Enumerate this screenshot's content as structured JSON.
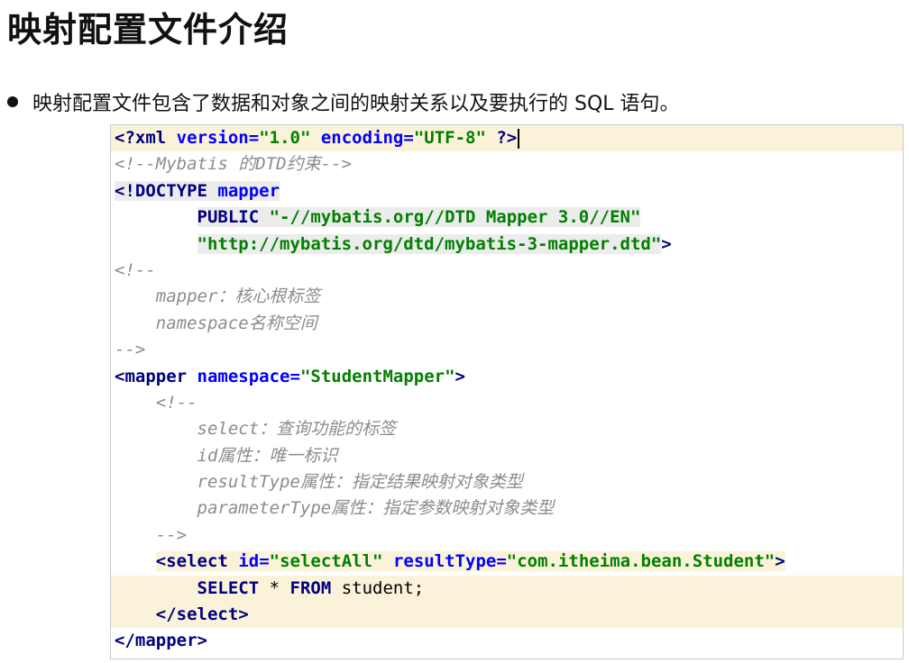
{
  "title": "映射配置文件介绍",
  "bullet": "映射配置文件包含了数据和对象之间的映射关系以及要执行的 SQL 语句。",
  "code": {
    "decl_open": "<?",
    "decl_xml": "xml",
    "decl_version_attr": "version",
    "decl_version_val": "\"1.0\"",
    "decl_encoding_attr": "encoding",
    "decl_encoding_val": "\"UTF-8\"",
    "decl_close": "?>",
    "comment_dtd": "<!--Mybatis 的DTD约束-->",
    "doctype_open": "<!DOCTYPE",
    "doctype_name": "mapper",
    "doctype_public": "PUBLIC",
    "doctype_public_id": "\"-//mybatis.org//DTD Mapper 3.0//EN\"",
    "doctype_system_id": "\"http://mybatis.org/dtd/mybatis-3-mapper.dtd\"",
    "doctype_close": ">",
    "comment1_open": "<!--",
    "comment1_line1": "mapper：核心根标签",
    "comment1_line2": "namespace名称空间",
    "comment1_close": "-->",
    "mapper_open_lt": "<",
    "mapper_tag": "mapper",
    "mapper_ns_attr": "namespace",
    "mapper_ns_val": "\"StudentMapper\"",
    "mapper_open_gt": ">",
    "comment2_open": "<!--",
    "comment2_line1": "select：查询功能的标签",
    "comment2_line2": "id属性：唯一标识",
    "comment2_line3": "resultType属性：指定结果映射对象类型",
    "comment2_line4": "parameterType属性：指定参数映射对象类型",
    "comment2_close": "-->",
    "select_lt": "<",
    "select_tag": "select",
    "select_id_attr": "id",
    "select_id_val": "\"selectAll\"",
    "select_rt_attr": "resultType",
    "select_rt_val": "\"com.itheima.bean.Student\"",
    "select_gt": ">",
    "sql_select": "SELECT",
    "sql_star": "*",
    "sql_from": "FROM",
    "sql_table": "student;",
    "select_close_lt": "</",
    "select_close_tag": "select",
    "select_close_gt": ">",
    "mapper_close_lt": "</",
    "mapper_close_tag": "mapper",
    "mapper_close_gt": ">"
  }
}
